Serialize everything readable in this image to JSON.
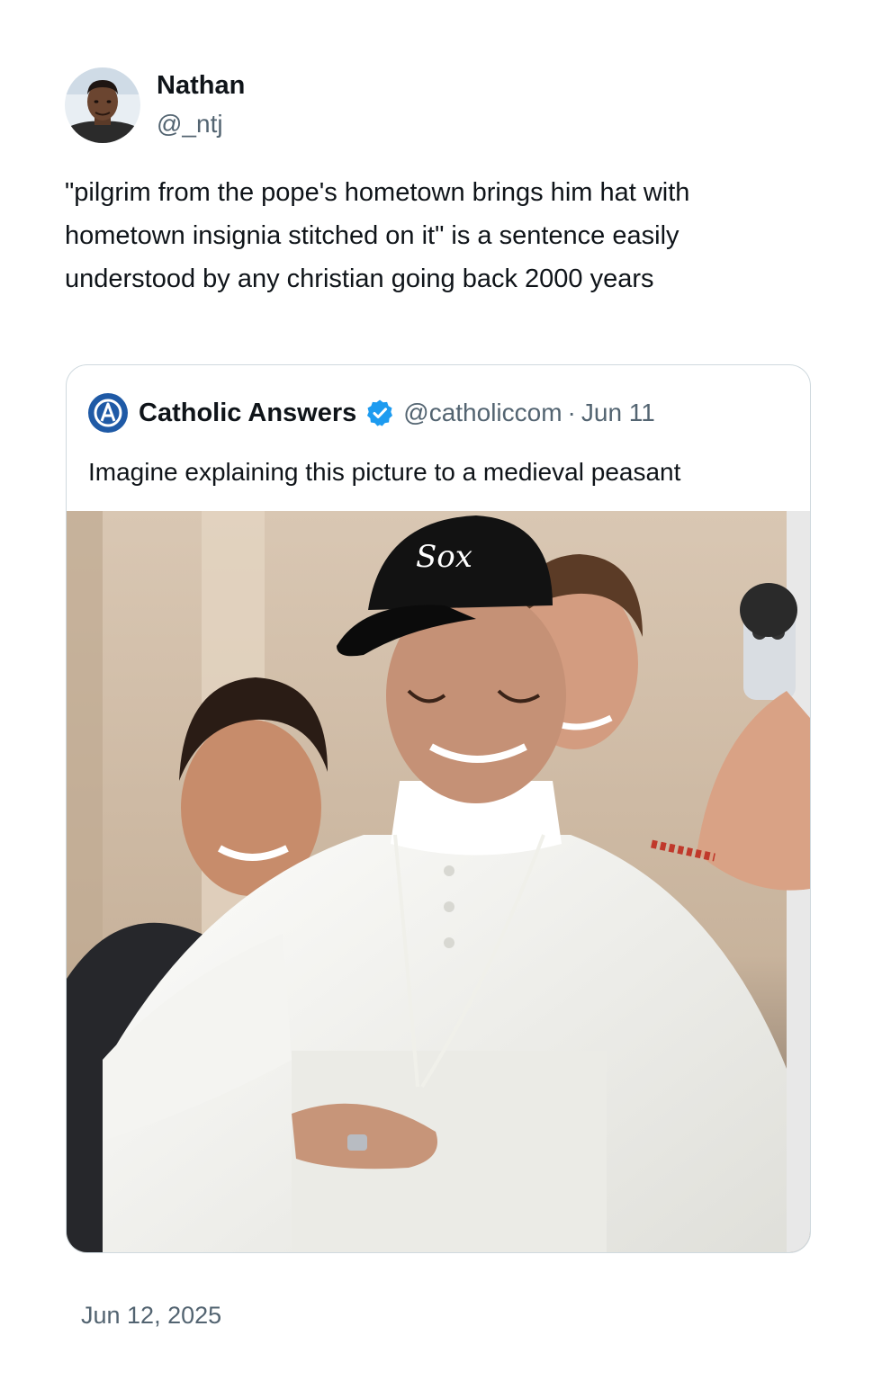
{
  "author": {
    "display_name": "Nathan",
    "handle": "@_ntj",
    "avatar_icon": "profile-photo"
  },
  "tweet": {
    "text": "\"pilgrim from the pope's hometown brings him hat with hometown insignia stitched on it\" is a sentence easily understood by any christian going back 2000 years",
    "timestamp": "Jun 12, 2025"
  },
  "quoted_tweet": {
    "logo_icon": "catholic-answers-logo",
    "display_name": "Catholic Answers",
    "verified_icon": "verified-badge-icon",
    "handle": "@catholiccom",
    "separator": "·",
    "date": "Jun 11",
    "text": "Imagine explaining this picture to a medieval peasant",
    "media": {
      "type": "photo",
      "cap_logo_text": "Sox"
    }
  },
  "colors": {
    "text_primary": "#0f1419",
    "text_secondary": "#536471",
    "border": "#cfd9de",
    "verified_blue": "#1d9bf0",
    "logo_blue": "#1f5aa6"
  }
}
